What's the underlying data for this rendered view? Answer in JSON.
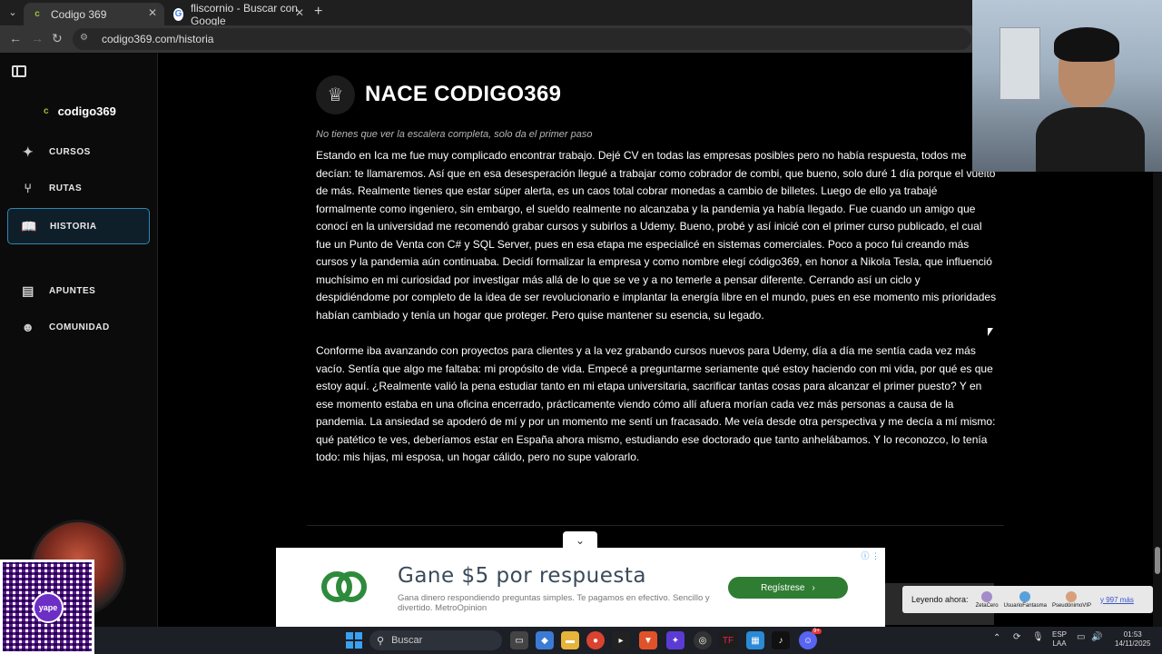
{
  "browser": {
    "tabs": [
      {
        "title": "Codigo 369",
        "active": true
      },
      {
        "title": "fliscornio - Buscar con Google",
        "active": false
      }
    ],
    "url": "codigo369.com/historia"
  },
  "sidebar": {
    "brand": "codigo369",
    "items": [
      {
        "label": "CURSOS",
        "icon": "sparkle-icon"
      },
      {
        "label": "RUTAS",
        "icon": "route-icon"
      },
      {
        "label": "HISTORIA",
        "icon": "book-icon",
        "active": true
      },
      {
        "label": "APUNTES",
        "icon": "notes-icon"
      },
      {
        "label": "COMUNIDAD",
        "icon": "community-icon"
      }
    ]
  },
  "article": {
    "title": "NACE CODIGO369",
    "subtitle": "No tienes que ver la escalera completa, solo da el primer paso",
    "paragraphs": [
      "Estando en Ica me fue muy complicado encontrar trabajo. Dejé CV en todas las empresas posibles pero no había respuesta, todos me decían: te llamaremos. Así que en esa desesperación llegué a trabajar como cobrador de combi, que bueno, solo duré 1 día porque el vuelto de más. Realmente tienes que estar súper alerta, es un caos total cobrar monedas a cambio de billetes. Luego de ello ya trabajé formalmente como ingeniero, sin embargo, el sueldo realmente no alcanzaba y la pandemia ya había llegado. Fue cuando un amigo que conocí en la universidad me recomendó grabar cursos y subirlos a Udemy. Bueno, probé y así inicié con el primer curso publicado, el cual fue un Punto de Venta con C# y SQL Server, pues en esa etapa me especialicé en sistemas comerciales. Poco a poco fui creando más cursos y la pandemia aún continuaba. Decidí formalizar la empresa y como nombre elegí código369, en honor a Nikola Tesla, que influenció muchísimo en mi curiosidad por investigar más allá de lo que se ve y a no temerle a pensar diferente. Cerrando así un ciclo y despidiéndome por completo de la idea de ser revolucionario e implantar la energía libre en el mundo, pues en ese momento mis prioridades habían cambiado y tenía un hogar que proteger. Pero quise mantener su esencia, su legado.",
      "Conforme iba avanzando con proyectos para clientes y a la vez grabando cursos nuevos para Udemy, día a día me sentía cada vez más vacío. Sentía que algo me faltaba: mi propósito de vida. Empecé a preguntarme seriamente qué estoy haciendo con mi vida, por qué es que estoy aquí. ¿Realmente valió la pena estudiar tanto en mi etapa universitaria, sacrificar tantas cosas para alcanzar el primer puesto? Y en ese momento estaba en una oficina encerrado, prácticamente viendo cómo allí afuera morían cada vez más personas a causa de la pandemia. La ansiedad se apoderó de mí y por un momento me sentí un fracasado. Me veía desde otra perspectiva y me decía a mí mismo: qué patético te ves, deberíamos estar en España ahora mismo, estudiando ese doctorado que tanto anhelábamos. Y lo reconozco, lo tenía todo: mis hijas, mi esposa, un hogar cálido, pero no supe valorarlo."
    ]
  },
  "ad": {
    "headline": "Gane $5 por respuesta",
    "body": "Gana dinero respondiendo preguntas simples. Te pagamos en efectivo. Sencillo y divertido. MetroOpinion",
    "cta": "Regístrese"
  },
  "qr": {
    "badge": "yape"
  },
  "reading_now": {
    "label": "Leyendo ahora:",
    "users": [
      "ZetaCero",
      "UsuarioFantasma",
      "PseudónimoVIP"
    ],
    "more": "y 997 más"
  },
  "taskbar": {
    "search_placeholder": "Buscar",
    "lang": "ESP",
    "lang_sub": "LAA",
    "time": "01:53",
    "date": "14/11/2025",
    "badge_count": "9+"
  }
}
